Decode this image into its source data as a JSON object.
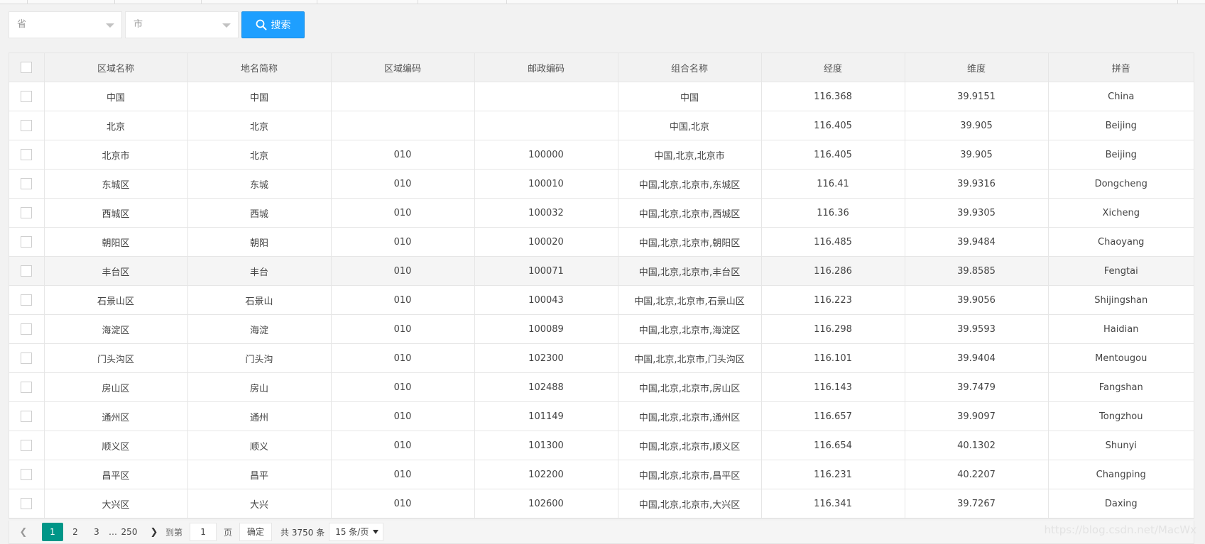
{
  "filter": {
    "province_placeholder": "省",
    "city_placeholder": "市",
    "search_label": "搜索"
  },
  "table": {
    "columns": [
      "区域名称",
      "地名简称",
      "区域编码",
      "邮政编码",
      "组合名称",
      "经度",
      "维度",
      "拼音"
    ],
    "rows": [
      [
        "中国",
        "中国",
        "",
        "",
        "中国",
        "116.368",
        "39.9151",
        "China"
      ],
      [
        "北京",
        "北京",
        "",
        "",
        "中国,北京",
        "116.405",
        "39.905",
        "Beijing"
      ],
      [
        "北京市",
        "北京",
        "010",
        "100000",
        "中国,北京,北京市",
        "116.405",
        "39.905",
        "Beijing"
      ],
      [
        "东城区",
        "东城",
        "010",
        "100010",
        "中国,北京,北京市,东城区",
        "116.41",
        "39.9316",
        "Dongcheng"
      ],
      [
        "西城区",
        "西城",
        "010",
        "100032",
        "中国,北京,北京市,西城区",
        "116.36",
        "39.9305",
        "Xicheng"
      ],
      [
        "朝阳区",
        "朝阳",
        "010",
        "100020",
        "中国,北京,北京市,朝阳区",
        "116.485",
        "39.9484",
        "Chaoyang"
      ],
      [
        "丰台区",
        "丰台",
        "010",
        "100071",
        "中国,北京,北京市,丰台区",
        "116.286",
        "39.8585",
        "Fengtai"
      ],
      [
        "石景山区",
        "石景山",
        "010",
        "100043",
        "中国,北京,北京市,石景山区",
        "116.223",
        "39.9056",
        "Shijingshan"
      ],
      [
        "海淀区",
        "海淀",
        "010",
        "100089",
        "中国,北京,北京市,海淀区",
        "116.298",
        "39.9593",
        "Haidian"
      ],
      [
        "门头沟区",
        "门头沟",
        "010",
        "102300",
        "中国,北京,北京市,门头沟区",
        "116.101",
        "39.9404",
        "Mentougou"
      ],
      [
        "房山区",
        "房山",
        "010",
        "102488",
        "中国,北京,北京市,房山区",
        "116.143",
        "39.7479",
        "Fangshan"
      ],
      [
        "通州区",
        "通州",
        "010",
        "101149",
        "中国,北京,北京市,通州区",
        "116.657",
        "39.9097",
        "Tongzhou"
      ],
      [
        "顺义区",
        "顺义",
        "010",
        "101300",
        "中国,北京,北京市,顺义区",
        "116.654",
        "40.1302",
        "Shunyi"
      ],
      [
        "昌平区",
        "昌平",
        "010",
        "102200",
        "中国,北京,北京市,昌平区",
        "116.231",
        "40.2207",
        "Changping"
      ],
      [
        "大兴区",
        "大兴",
        "010",
        "102600",
        "中国,北京,北京市,大兴区",
        "116.341",
        "39.7267",
        "Daxing"
      ]
    ],
    "hovered_row_index": 6
  },
  "pager": {
    "prev_icon": "chevron-left-icon",
    "next_icon": "chevron-right-icon",
    "pages": [
      "1",
      "2",
      "3"
    ],
    "current_page": "1",
    "ellipsis": "…",
    "last_page": "250",
    "goto_label": "到第",
    "goto_value": "1",
    "page_unit": "页",
    "confirm_label": "确定",
    "total_label": "共 3750 条",
    "page_size_label": "15 条/页"
  },
  "watermark": "https://blog.csdn.net/MacWx",
  "colors": {
    "accent": "#1e9fff",
    "active_page": "#009688"
  }
}
